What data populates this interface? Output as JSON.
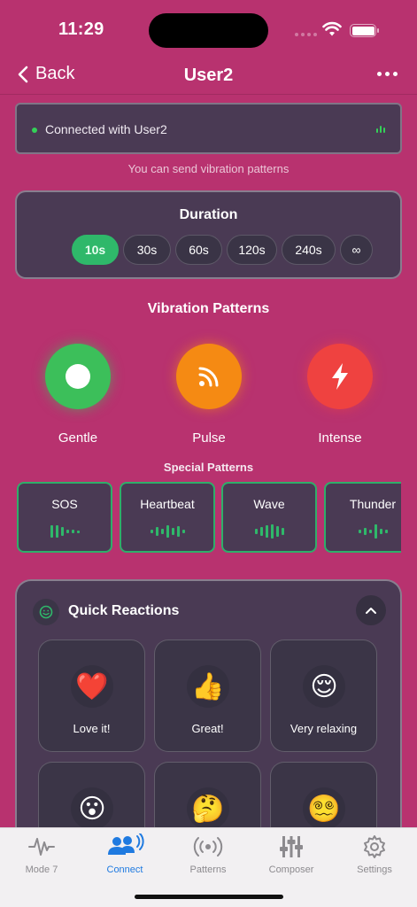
{
  "status": {
    "time": "11:29"
  },
  "nav": {
    "back_label": "Back",
    "title": "User2"
  },
  "connection": {
    "text": "Connected with User2",
    "hint": "You can send vibration patterns"
  },
  "duration": {
    "title": "Duration",
    "options": [
      "10s",
      "30s",
      "60s",
      "120s",
      "240s",
      "∞"
    ],
    "selected": "10s"
  },
  "patterns": {
    "title": "Vibration Patterns",
    "items": [
      {
        "label": "Gentle",
        "icon": "circle-icon",
        "color": "#3cbf5a"
      },
      {
        "label": "Pulse",
        "icon": "rss-icon",
        "color": "#f58a13"
      },
      {
        "label": "Intense",
        "icon": "bolt-icon",
        "color": "#ef4240"
      }
    ]
  },
  "special": {
    "title": "Special Patterns",
    "items": [
      "SOS",
      "Heartbeat",
      "Wave",
      "Thunder"
    ]
  },
  "quick_reactions": {
    "title": "Quick Reactions",
    "items": [
      {
        "emoji": "❤️",
        "label": "Love it!"
      },
      {
        "emoji": "👍",
        "label": "Great!"
      },
      {
        "emoji": "😌",
        "label": "Very relaxing"
      },
      {
        "emoji": "😮",
        "label": ""
      },
      {
        "emoji": "🤔",
        "label": ""
      },
      {
        "emoji": "😵‍💫",
        "label": ""
      }
    ]
  },
  "tabbar": {
    "items": [
      "Mode 7",
      "Connect",
      "Patterns",
      "Composer",
      "Settings"
    ],
    "active": "Connect"
  },
  "colors": {
    "background": "#b8326f",
    "accent_green": "#2fb86a",
    "tab_active": "#1f7ae0"
  }
}
